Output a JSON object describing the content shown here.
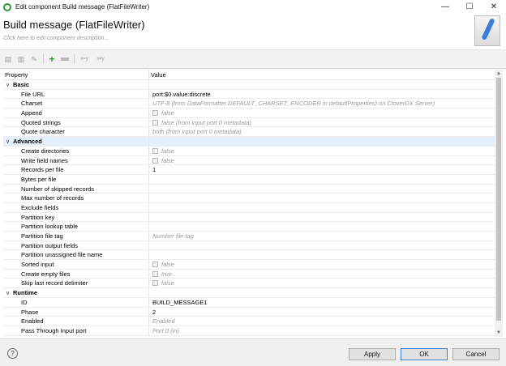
{
  "window": {
    "title": "Edit component Build message (FlatFileWriter)",
    "controls": {
      "minimize": "—",
      "maximize": "☐",
      "close": "✕"
    }
  },
  "header": {
    "title": "Build message (FlatFileWriter)",
    "description_placeholder": "Click here to edit component description..."
  },
  "toolbar": {
    "icons": [
      "copy-icon",
      "paste-icon",
      "edit-icon",
      "add-icon",
      "remove-icon",
      "move-down-icon",
      "move-up-icon"
    ],
    "small_labels": [
      "x=y",
      "x≠y"
    ]
  },
  "grid": {
    "columns": {
      "property": "Property",
      "value": "Value"
    },
    "categories": {
      "basic": "Basic",
      "advanced": "Advanced",
      "runtime": "Runtime"
    },
    "rows": {
      "file_url": {
        "label": "File URL",
        "value": "port:$0.value:discrete"
      },
      "charset": {
        "label": "Charset",
        "value": "UTF-8 (from DataFormatter.DEFAULT_CHARSET_ENCODER in defaultProperties) on CloverDX Server)"
      },
      "append": {
        "label": "Append",
        "value": "false"
      },
      "quoted_strings": {
        "label": "Quoted strings",
        "value": "false (from input port 0 metadata)"
      },
      "quote_character": {
        "label": "Quote character",
        "value": "both (from input port 0 metadata)"
      },
      "create_directories": {
        "label": "Create directories",
        "value": "false"
      },
      "write_field_names": {
        "label": "Write field names",
        "value": "false"
      },
      "records_per_file": {
        "label": "Records per file",
        "value": "1"
      },
      "bytes_per_file": {
        "label": "Bytes per file",
        "value": ""
      },
      "skipped_records": {
        "label": "Number of skipped records",
        "value": ""
      },
      "max_records": {
        "label": "Max number of records",
        "value": ""
      },
      "exclude_fields": {
        "label": "Exclude fields",
        "value": ""
      },
      "partition_key": {
        "label": "Partition key",
        "value": ""
      },
      "partition_lookup": {
        "label": "Partition lookup table",
        "value": ""
      },
      "partition_file_tag": {
        "label": "Partition file tag",
        "value": "Number file tag"
      },
      "partition_output_fields": {
        "label": "Partition output fields",
        "value": ""
      },
      "partition_unassigned": {
        "label": "Partition unassigned file name",
        "value": ""
      },
      "sorted_input": {
        "label": "Sorted input",
        "value": "false"
      },
      "create_empty_files": {
        "label": "Create empty files",
        "value": "true"
      },
      "skip_last_delimiter": {
        "label": "Skip last record delimiter",
        "value": "false"
      },
      "id": {
        "label": "ID",
        "value": "BUILD_MESSAGE1"
      },
      "phase": {
        "label": "Phase",
        "value": "2"
      },
      "enabled": {
        "label": "Enabled",
        "value": "Enabled"
      },
      "pass_through": {
        "label": "Pass Through Input port",
        "value": "Port 0 (in)"
      }
    }
  },
  "footer": {
    "help": "?",
    "apply": "Apply",
    "ok": "OK",
    "cancel": "Cancel"
  }
}
